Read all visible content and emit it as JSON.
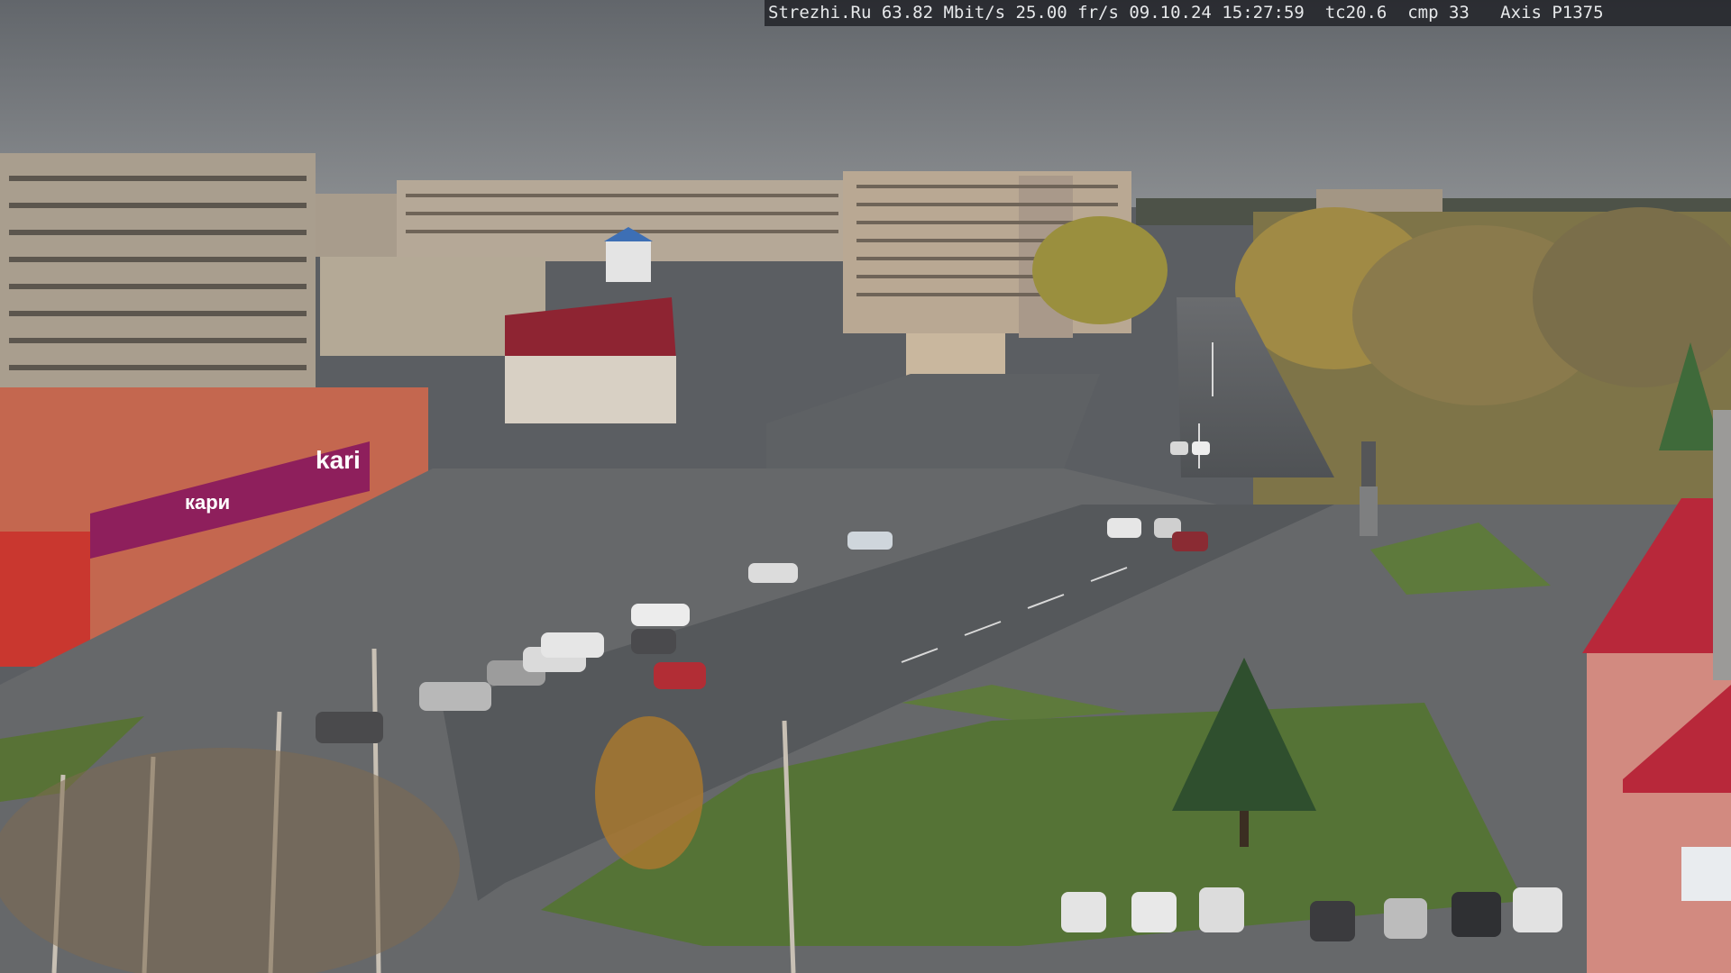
{
  "overlay": {
    "text": "Strezhi.Ru 63.82 Mbit/s 25.00 fr/s 09.10.24 15:27:59  tc20.6  cmp 33   Axis P1375"
  },
  "signs": {
    "store_logo": "kari",
    "store_banner": "кари"
  },
  "colors": {
    "sky": "#6b6f74",
    "brick": "#c4674f",
    "magenta": "#8e1f5c",
    "roof_red": "#b8283a",
    "grass": "#5e7a3c",
    "road": "#55585b"
  }
}
